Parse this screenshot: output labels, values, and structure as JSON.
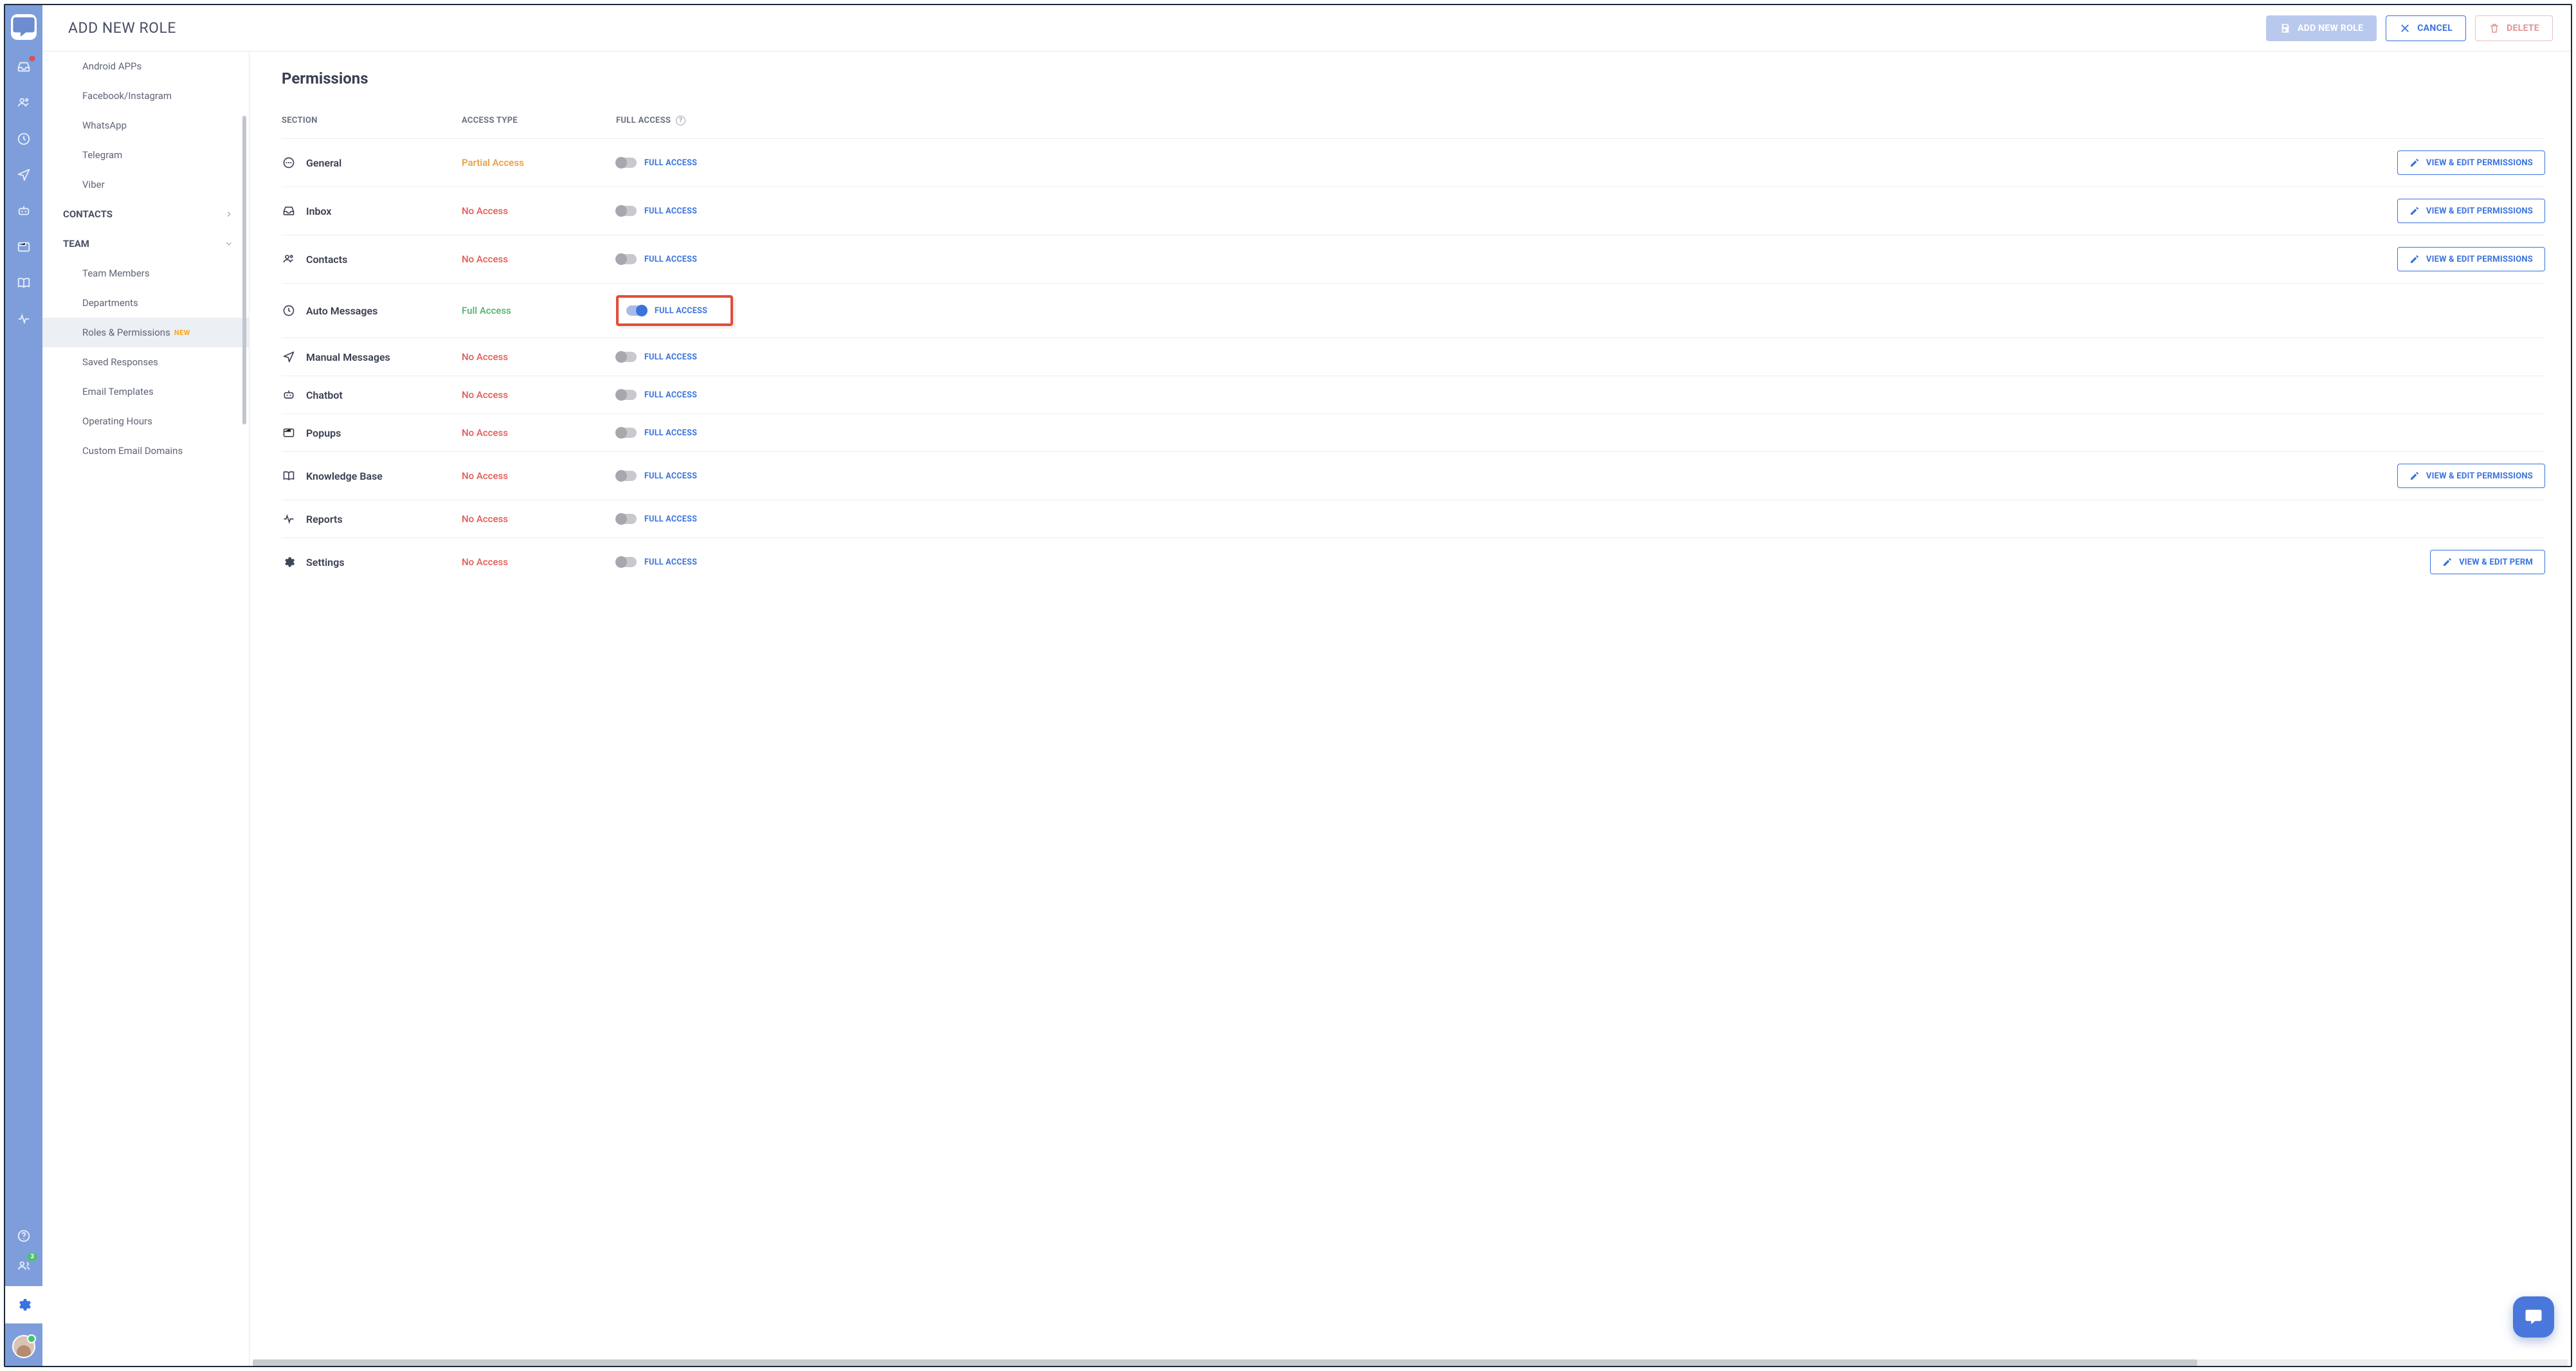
{
  "header": {
    "title": "ADD NEW ROLE",
    "add_label": "ADD NEW ROLE",
    "cancel_label": "CANCEL",
    "delete_label": "DELETE"
  },
  "rail": {
    "people_badge": "3"
  },
  "sidebar": {
    "channels": {
      "items": [
        {
          "label": "Android APPs"
        },
        {
          "label": "Facebook/Instagram"
        },
        {
          "label": "WhatsApp"
        },
        {
          "label": "Telegram"
        },
        {
          "label": "Viber"
        }
      ]
    },
    "contacts_group": "CONTACTS",
    "team_group": "TEAM",
    "team_items": [
      {
        "label": "Team Members"
      },
      {
        "label": "Departments"
      },
      {
        "label": "Roles & Permissions",
        "new_tag": "NEW",
        "active": true
      },
      {
        "label": "Saved Responses"
      },
      {
        "label": "Email Templates"
      },
      {
        "label": "Operating Hours"
      },
      {
        "label": "Custom Email Domains"
      }
    ]
  },
  "main": {
    "title": "Permissions",
    "columns": {
      "section": "SECTION",
      "access": "ACCESS TYPE",
      "full": "FULL ACCESS"
    },
    "toggle_label": "FULL ACCESS",
    "edit_label": "VIEW & EDIT PERMISSIONS",
    "edit_label_cut": "VIEW & EDIT PERM",
    "rows": [
      {
        "icon": "dots",
        "label": "General",
        "access": "Partial Access",
        "access_cls": "partial",
        "on": false,
        "edit": true,
        "highlight": false
      },
      {
        "icon": "inbox",
        "label": "Inbox",
        "access": "No Access",
        "access_cls": "none",
        "on": false,
        "edit": true,
        "highlight": false
      },
      {
        "icon": "contacts",
        "label": "Contacts",
        "access": "No Access",
        "access_cls": "none",
        "on": false,
        "edit": true,
        "highlight": false
      },
      {
        "icon": "clock",
        "label": "Auto Messages",
        "access": "Full Access",
        "access_cls": "full",
        "on": true,
        "edit": false,
        "highlight": true
      },
      {
        "icon": "send",
        "label": "Manual Messages",
        "access": "No Access",
        "access_cls": "none",
        "on": false,
        "edit": false,
        "highlight": false
      },
      {
        "icon": "bot",
        "label": "Chatbot",
        "access": "No Access",
        "access_cls": "none",
        "on": false,
        "edit": false,
        "highlight": false
      },
      {
        "icon": "popup",
        "label": "Popups",
        "access": "No Access",
        "access_cls": "none",
        "on": false,
        "edit": false,
        "highlight": false
      },
      {
        "icon": "book",
        "label": "Knowledge Base",
        "access": "No Access",
        "access_cls": "none",
        "on": false,
        "edit": true,
        "highlight": false
      },
      {
        "icon": "pulse",
        "label": "Reports",
        "access": "No Access",
        "access_cls": "none",
        "on": false,
        "edit": false,
        "highlight": false
      },
      {
        "icon": "gear",
        "label": "Settings",
        "access": "No Access",
        "access_cls": "none",
        "on": false,
        "edit": true,
        "edit_cut": true,
        "highlight": false
      }
    ]
  }
}
